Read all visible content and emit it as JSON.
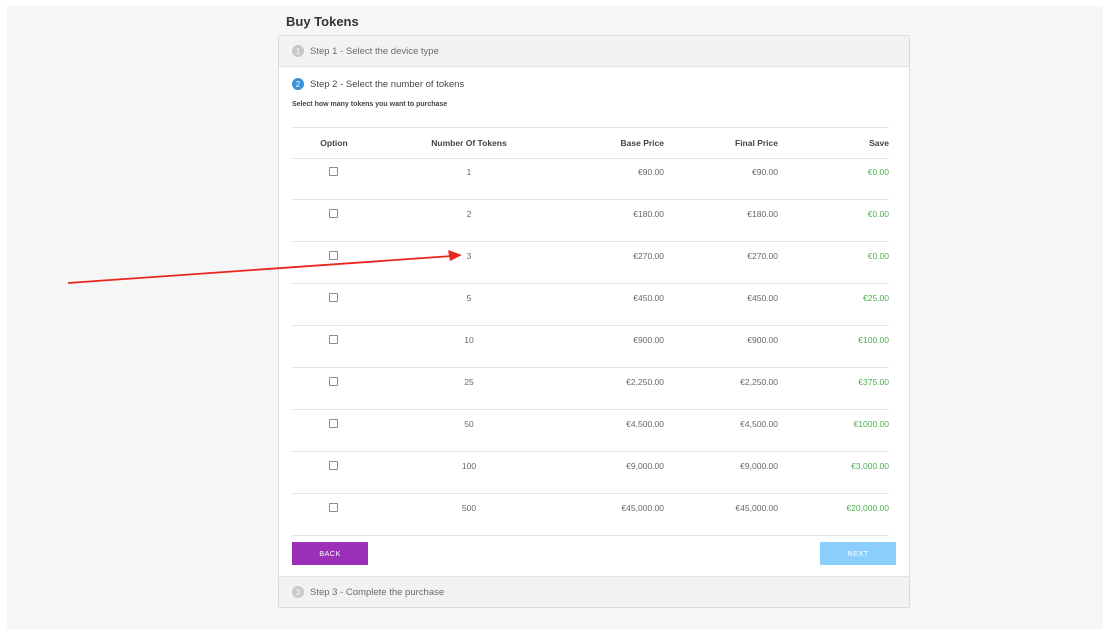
{
  "page": {
    "title": "Buy Tokens"
  },
  "steps": {
    "step1": {
      "num": "1",
      "label": "Step 1 - Select the device type"
    },
    "step2": {
      "num": "2",
      "label": "Step 2 - Select the number of tokens",
      "subtitle": "Select how many tokens you want to purchase"
    },
    "step3": {
      "num": "3",
      "label": "Step 3 - Complete the purchase"
    }
  },
  "table": {
    "headers": {
      "option": "Option",
      "tokens": "Number Of Tokens",
      "base": "Base Price",
      "final": "Final Price",
      "save": "Save"
    },
    "rows": [
      {
        "tokens": "1",
        "base": "€90.00",
        "final": "€90.00",
        "save": "€0.00"
      },
      {
        "tokens": "2",
        "base": "€180.00",
        "final": "€180.00",
        "save": "€0.00"
      },
      {
        "tokens": "3",
        "base": "€270.00",
        "final": "€270.00",
        "save": "€0.00"
      },
      {
        "tokens": "5",
        "base": "€450.00",
        "final": "€450.00",
        "save": "€25.00"
      },
      {
        "tokens": "10",
        "base": "€900.00",
        "final": "€900.00",
        "save": "€100.00"
      },
      {
        "tokens": "25",
        "base": "€2,250.00",
        "final": "€2,250.00",
        "save": "€375.00"
      },
      {
        "tokens": "50",
        "base": "€4,500.00",
        "final": "€4,500.00",
        "save": "€1000.00"
      },
      {
        "tokens": "100",
        "base": "€9,000.00",
        "final": "€9,000.00",
        "save": "€3,000.00"
      },
      {
        "tokens": "500",
        "base": "€45,000.00",
        "final": "€45,000.00",
        "save": "€20,000.00"
      }
    ]
  },
  "buttons": {
    "back": "BACK",
    "next": "NEXT"
  },
  "colors": {
    "back": "#9b2fb8",
    "next": "#8ccfff",
    "save_text": "#4caf50",
    "step_active": "#3a8fd9",
    "annotation_arrow": "#e8261c"
  }
}
